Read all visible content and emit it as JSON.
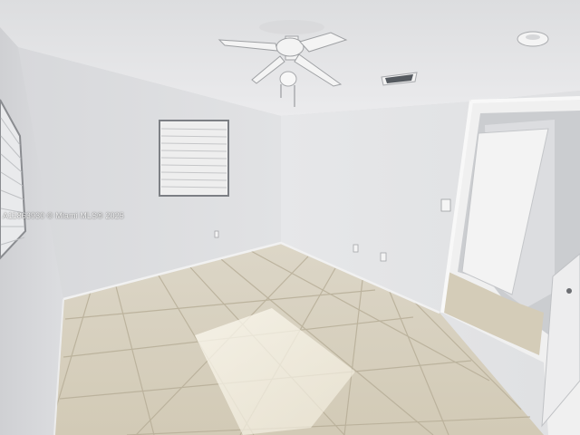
{
  "photo": {
    "watermark": "A11863930 © Miami MLS® 2025"
  },
  "objects": [
    "ceiling-fan-icon",
    "window-blinds",
    "open-doorway",
    "smoke-detector-icon",
    "air-vent-icon",
    "wall-outlet-icon",
    "light-switch-icon",
    "tile-floor"
  ],
  "colors": {
    "wall": "#e2e3e5",
    "ceiling": "#e6e6e8",
    "floor_tile": "#d6ceb9",
    "grout": "#b7ad97",
    "sunlight": "#f6f2e6"
  }
}
